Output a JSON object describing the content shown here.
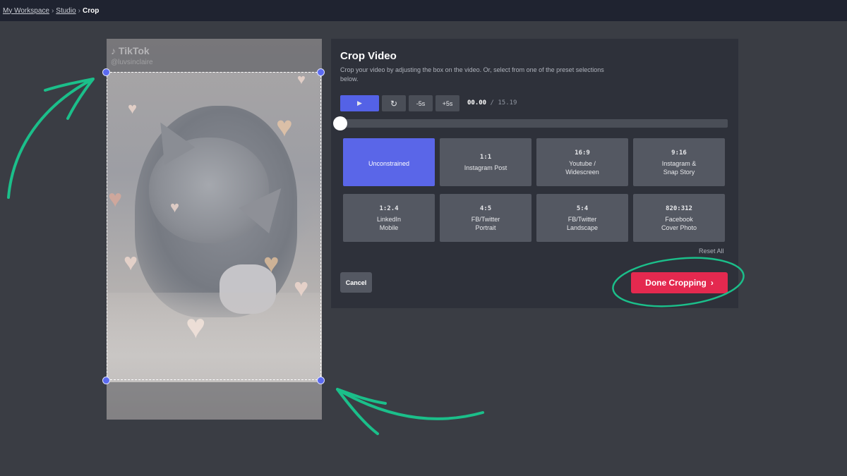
{
  "breadcrumb": {
    "workspace": "My Workspace",
    "studio": "Studio",
    "current": "Crop",
    "separator": "›"
  },
  "video": {
    "watermark": "♪ TikTok",
    "username": "@luvsinclaire"
  },
  "panel": {
    "title": "Crop Video",
    "description": "Crop your video by adjusting the box on the video. Or, select from one of the preset selections below.",
    "controls": {
      "play_icon": "play-icon",
      "play_glyph": "▶",
      "restart_glyph": "↻",
      "back_label": "-5s",
      "forward_label": "+5s"
    },
    "time": {
      "current": "00.00",
      "separator": "/",
      "total": "15.19"
    },
    "scrub_position": 0,
    "presets": [
      {
        "ratio": "",
        "line1": "Unconstrained",
        "line2": "",
        "active": true
      },
      {
        "ratio": "1:1",
        "line1": "Instagram Post",
        "line2": "",
        "active": false
      },
      {
        "ratio": "16:9",
        "line1": "Youtube /",
        "line2": "Widescreen",
        "active": false
      },
      {
        "ratio": "9:16",
        "line1": "Instagram &",
        "line2": "Snap Story",
        "active": false
      },
      {
        "ratio": "1:2.4",
        "line1": "LinkedIn",
        "line2": "Mobile",
        "active": false
      },
      {
        "ratio": "4:5",
        "line1": "FB/Twitter",
        "line2": "Portrait",
        "active": false
      },
      {
        "ratio": "5:4",
        "line1": "FB/Twitter",
        "line2": "Landscape",
        "active": false
      },
      {
        "ratio": "820:312",
        "line1": "Facebook",
        "line2": "Cover Photo",
        "active": false
      }
    ],
    "reset_all": "Reset All",
    "cancel": "Cancel",
    "done": "Done Cropping",
    "done_glyph": "›"
  },
  "colors": {
    "accent": "#5a66e8",
    "done": "#e4294f",
    "annotation": "#1bbf8a"
  }
}
